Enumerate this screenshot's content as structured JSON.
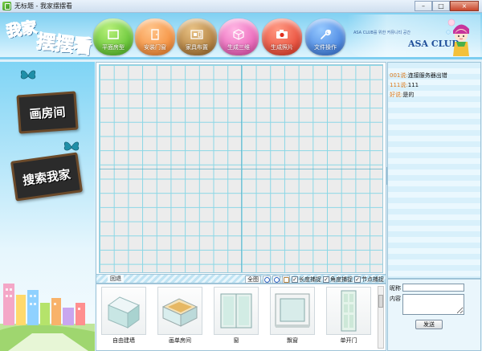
{
  "window": {
    "title": "无标题 - 我家摆摆看",
    "minimize": "–",
    "maximize": "□",
    "close": "×"
  },
  "header": {
    "logo_line1": "我家",
    "logo_line2": "摆摆看",
    "tools": [
      {
        "label": "平面房型",
        "icon": "floor-plan-icon"
      },
      {
        "label": "安装门窗",
        "icon": "door-window-icon"
      },
      {
        "label": "家具布置",
        "icon": "furniture-icon"
      },
      {
        "label": "生成三维",
        "icon": "cube-icon"
      },
      {
        "label": "生成照片",
        "icon": "camera-icon"
      },
      {
        "label": "文件操作",
        "icon": "wrench-icon"
      }
    ],
    "club_sub": "ASA CLUB를 위한 커뮤니티 공간",
    "club_title": "ASA CLUB"
  },
  "left": {
    "draw_room": "画房间",
    "search_home": "搜索我家"
  },
  "canvas_toolbar": {
    "undo": "回退",
    "fullview": "全图",
    "length_snap": "长度捕捉",
    "angle_snap": "角度捕捉",
    "node_snap": "节点捕捉",
    "check_mark": "✓"
  },
  "palette": {
    "items": [
      {
        "label": "自由建墙"
      },
      {
        "label": "画单房间"
      },
      {
        "label": "窗"
      },
      {
        "label": "飘窗"
      },
      {
        "label": "单开门"
      }
    ]
  },
  "chat": {
    "messages": [
      {
        "who": "001说:",
        "text": "连接服务器出错"
      },
      {
        "who": "111说:",
        "text": "111"
      },
      {
        "who": "好说:",
        "text": "是的"
      }
    ],
    "nick_label": "昵称",
    "content_label": "内容",
    "send": "发送"
  },
  "colors": {
    "header_blue": "#7fd0f2",
    "grid_line": "#8ad7e6",
    "accent_orange": "#e07a1a"
  }
}
